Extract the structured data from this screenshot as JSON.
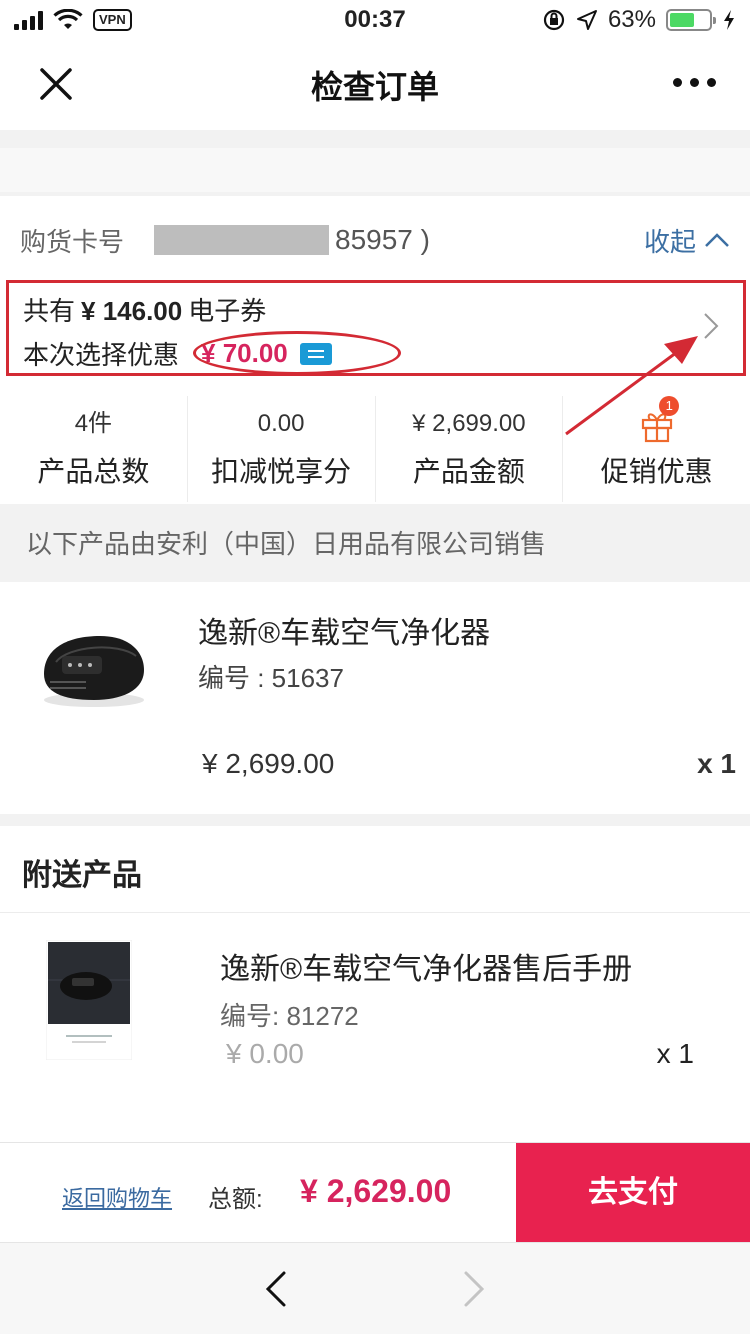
{
  "status_bar": {
    "vpn_label": "VPN",
    "time": "00:37",
    "battery_percent": "63%",
    "battery_fill": 0.63,
    "icons": [
      "signal-icon",
      "wifi-icon",
      "lock-rotation-icon",
      "location-icon",
      "battery-icon",
      "charging-icon"
    ]
  },
  "nav": {
    "title": "检查订单",
    "close_icon": "close-icon",
    "more_icon": "more-icon"
  },
  "card": {
    "label": "购货卡号",
    "number_suffix": "85957 )",
    "collapse_label": "收起"
  },
  "coupon": {
    "prefix": "共有",
    "total_amount": "¥ 146.00",
    "suffix": "电子券",
    "selected_label": "本次选择优惠",
    "selected_amount": "¥ 70.00"
  },
  "stats": [
    {
      "value": "4件",
      "label": "产品总数"
    },
    {
      "value": "0.00",
      "label": "扣减悦享分"
    },
    {
      "value": "¥ 2,699.00",
      "label": "产品金额"
    },
    {
      "label": "促销优惠",
      "badge": "1",
      "icon": "gift-icon"
    }
  ],
  "seller_notice": "以下产品由安利（中国）日用品有限公司销售",
  "product": {
    "name": "逸新®车载空气净化器",
    "sku": "编号 : 51637",
    "price": "¥  2,699.00",
    "quantity": "x 1"
  },
  "gift_section": {
    "title": "附送产品",
    "item": {
      "name": "逸新®车载空气净化器售后手册",
      "sku": "编号:  81272",
      "price": "¥  0.00",
      "quantity": "x 1"
    }
  },
  "footer": {
    "back_to_cart": "返回购物车",
    "total_label": "总额:",
    "total_amount": "¥  2,629.00",
    "pay_button": "去支付"
  },
  "colors": {
    "accent_red": "#e8224f",
    "price_red": "#d6245e",
    "link_blue": "#3b6aa0",
    "annotation_red": "#d32a34"
  }
}
